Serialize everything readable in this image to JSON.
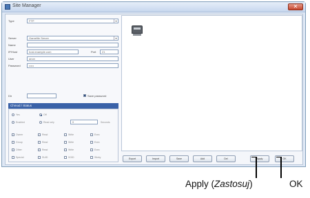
{
  "window": {
    "title": "Site Manager",
    "close_glyph": "✕"
  },
  "form": {
    "type_value": "FTP",
    "server_value": "Gamefile Server",
    "host_value": "host.example.com",
    "port_label": "Port",
    "port_value": "21",
    "user_value": "anon",
    "password_value": "•••••",
    "path_value": "",
    "save_password_label": "Save password"
  },
  "advanced": {
    "header": "Chmod / Status",
    "radio_labels": [
      "Yes",
      "Off"
    ],
    "option_labels": [
      "Enabled",
      "Read only"
    ],
    "value": "0",
    "value_suffix": "Seconds",
    "checkbox_rows": [
      [
        "Owner",
        "Read",
        "Write",
        "Exec"
      ],
      [
        "Group",
        "Read",
        "Write",
        "Exec"
      ],
      [
        "Other",
        "Read",
        "Write",
        "Exec"
      ],
      [
        "Special",
        "SUID",
        "SGID",
        "Sticky"
      ]
    ]
  },
  "buttons": {
    "b1": "Export",
    "b2": "Import",
    "b3": "Save",
    "b4": "Add",
    "b5": "Del",
    "apply": "Apply",
    "ok": "OK"
  },
  "annotation": {
    "apply_text": "Apply (",
    "apply_italic": "Zastosuj",
    "apply_close": ")",
    "ok_text": "OK"
  },
  "icons": [
    "close-icon",
    "app-icon",
    "site-icon",
    "chevron-down-icon"
  ],
  "colors": {
    "section_header": "#3a62a8",
    "close_button": "#c6462d"
  }
}
